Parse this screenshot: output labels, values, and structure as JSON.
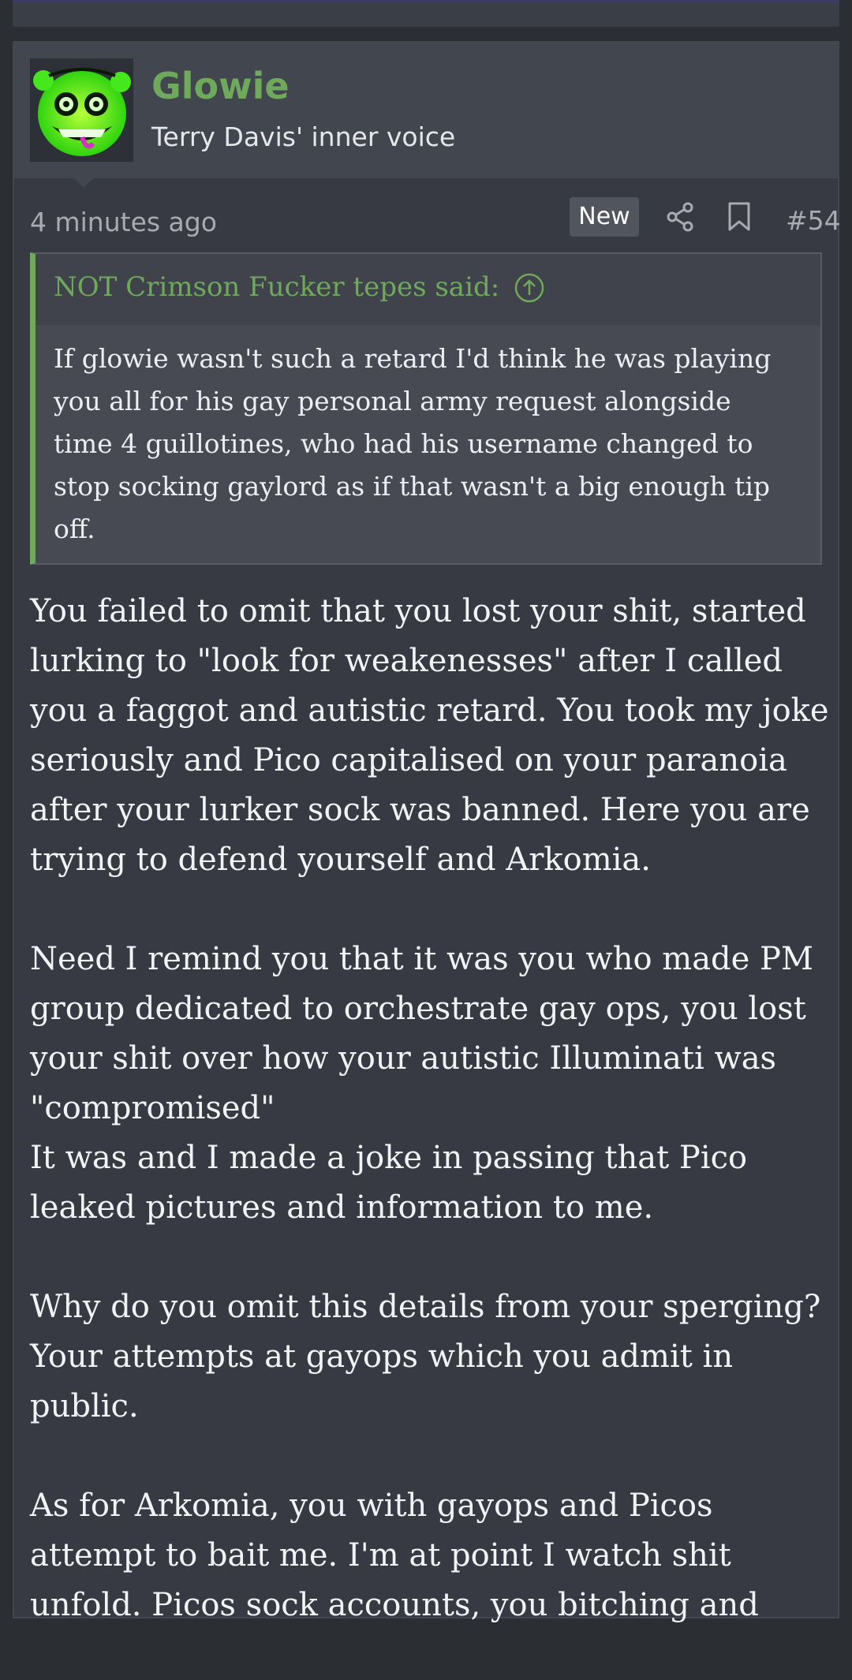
{
  "post": {
    "username": "Glowie",
    "user_title": "Terry Davis' inner voice",
    "timestamp": "4 minutes ago",
    "badge": "New",
    "post_number": "#54",
    "icons": {
      "share": "share-icon",
      "bookmark": "bookmark-icon",
      "quote_jump": "arrow-up-circle-icon"
    },
    "colors": {
      "accent": "#6faa5c",
      "background": "#373a42",
      "header": "#42464f"
    }
  },
  "quote": {
    "author": "NOT Crimson Fucker tepes said:",
    "lines": [
      "If glowie wasn't such a retard I'd think he was playing",
      "you all for his gay personal army request alongside",
      "time 4 guillotines, who had his username changed to",
      "stop socking gaylord as if that wasn't a big enough tip",
      "off."
    ]
  },
  "message": {
    "p1": [
      "You failed to omit that you lost your shit, started",
      "lurking to \"look for weakenesses\" after I called",
      "you a faggot and autistic retard. You took my joke",
      "seriously and Pico capitalised on your paranoia",
      "after your lurker sock was banned. Here you are",
      "trying to defend yourself and Arkomia."
    ],
    "p2": [
      "Need I remind you that it was you who made PM",
      "group dedicated to orchestrate gay ops, you lost",
      "your shit over how your autistic Illuminati was",
      "\"compromised\"",
      "It was and I made a joke in passing that Pico",
      "leaked pictures and information to me."
    ],
    "p3": [
      "Why do you omit this details from your sperging?",
      "Your attempts at gayops which you admit in",
      "public."
    ],
    "p4": [
      "As for Arkomia, you with gayops and Picos",
      "attempt to bait me. I'm at point I watch shit",
      "unfold. Picos sock accounts, you bitching and"
    ]
  }
}
